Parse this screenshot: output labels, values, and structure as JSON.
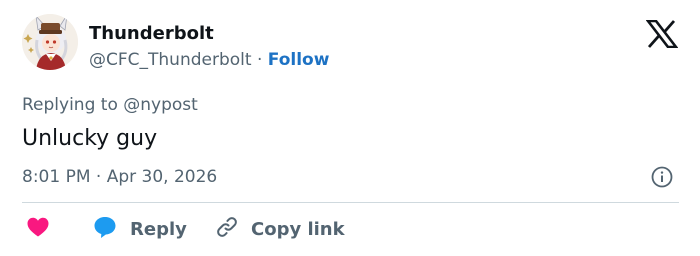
{
  "user": {
    "display_name": "Thunderbolt",
    "handle": "@CFC_Thunderbolt",
    "separator": "·",
    "follow_label": "Follow",
    "avatar_icon": "anime-character-avatar"
  },
  "tweet": {
    "replying_prefix": "Replying to",
    "replying_to": "@nypost",
    "text": "Unlucky guy",
    "timestamp": "8:01 PM · Apr 30, 2026"
  },
  "actions": {
    "reply_label": "Reply",
    "copy_link_label": "Copy link"
  },
  "colors": {
    "accent": "#1d72c4",
    "like": "#f91880",
    "reply_bubble": "#1d9bf0",
    "muted": "#536471",
    "text": "#0f1419",
    "divider": "#cfd9de"
  }
}
